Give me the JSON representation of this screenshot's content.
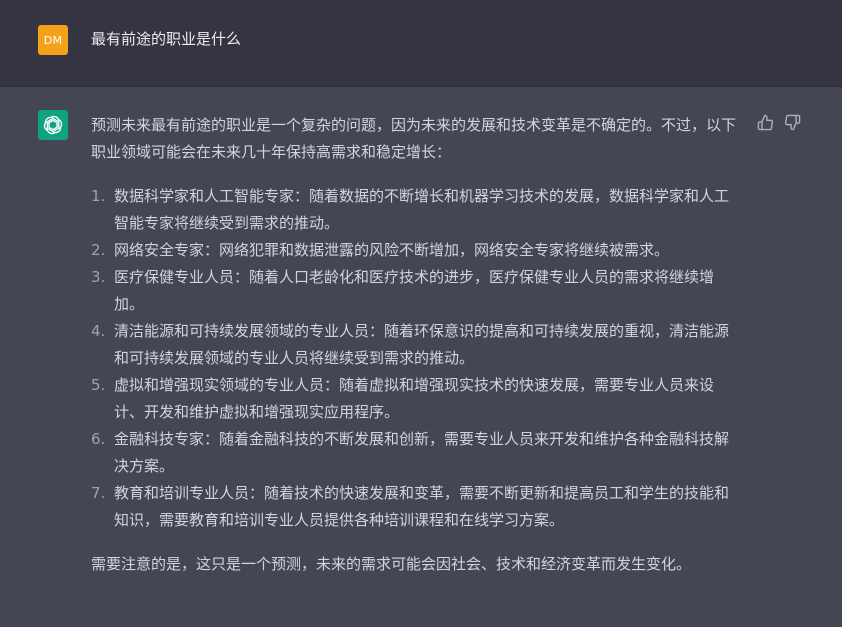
{
  "user": {
    "avatar_initials": "DM",
    "avatar_color": "#f5a21b",
    "message": "最有前途的职业是什么"
  },
  "assistant": {
    "avatar_icon": "openai-logo-icon",
    "avatar_color": "#10a37f",
    "intro": "预测未来最有前途的职业是一个复杂的问题，因为未来的发展和技术变革是不确定的。不过，以下职业领域可能会在未来几十年保持高需求和稳定增长：",
    "items": [
      {
        "num": "1.",
        "text": "数据科学家和人工智能专家：随着数据的不断增长和机器学习技术的发展，数据科学家和人工智能专家将继续受到需求的推动。"
      },
      {
        "num": "2.",
        "text": "网络安全专家：网络犯罪和数据泄露的风险不断增加，网络安全专家将继续被需求。"
      },
      {
        "num": "3.",
        "text": "医疗保健专业人员：随着人口老龄化和医疗技术的进步，医疗保健专业人员的需求将继续增加。"
      },
      {
        "num": "4.",
        "text": "清洁能源和可持续发展领域的专业人员：随着环保意识的提高和可持续发展的重视，清洁能源和可持续发展领域的专业人员将继续受到需求的推动。"
      },
      {
        "num": "5.",
        "text": "虚拟和增强现实领域的专业人员：随着虚拟和增强现实技术的快速发展，需要专业人员来设计、开发和维护虚拟和增强现实应用程序。"
      },
      {
        "num": "6.",
        "text": "金融科技专家：随着金融科技的不断发展和创新，需要专业人员来开发和维护各种金融科技解决方案。"
      },
      {
        "num": "7.",
        "text": "教育和培训专业人员：随着技术的快速发展和变革，需要不断更新和提高员工和学生的技能和知识，需要教育和培训专业人员提供各种培训课程和在线学习方案。"
      }
    ],
    "outro": "需要注意的是，这只是一个预测，未来的需求可能会因社会、技术和经济变革而发生变化。",
    "feedback": {
      "up_icon": "thumbs-up-icon",
      "down_icon": "thumbs-down-icon"
    }
  }
}
